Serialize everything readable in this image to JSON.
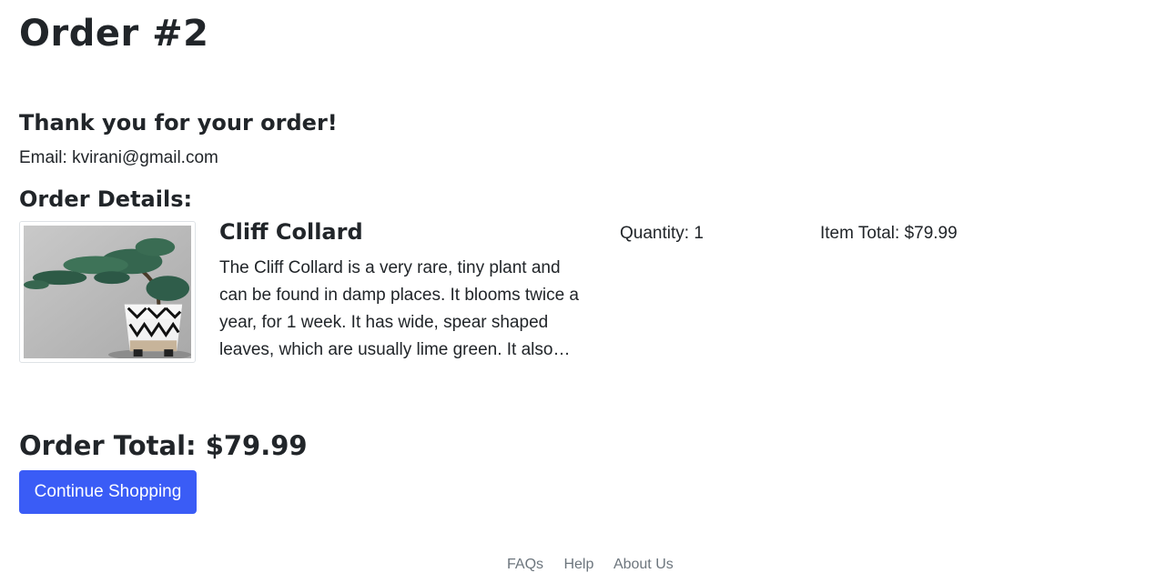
{
  "order": {
    "title": "Order #2",
    "thank_you": "Thank you for your order!",
    "email_line": "Email: kvirani@gmail.com",
    "details_heading": "Order Details:"
  },
  "items": [
    {
      "name": "Cliff Collard",
      "description": "The Cliff Collard is a very rare, tiny plant and can be found in damp places. It blooms twice a year, for 1 week. It has wide, spear shaped leaves, which are usually lime green. It also grows quickly.",
      "quantity": "Quantity: 1",
      "item_total": "Item Total: $79.99",
      "image_icon": "bonsai-plant-image"
    }
  ],
  "summary": {
    "order_total": "Order Total: $79.99",
    "continue_label": "Continue Shopping"
  },
  "footer": {
    "links": [
      "FAQs",
      "Help",
      "About Us"
    ]
  },
  "colors": {
    "primary": "#3a5cf6",
    "text": "#212529"
  }
}
